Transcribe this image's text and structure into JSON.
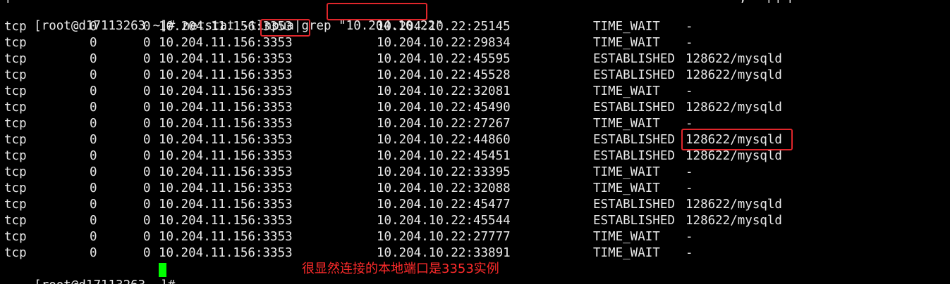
{
  "terminal": {
    "cut_line_fragments": [
      "|",
      ",",
      "|",
      "|",
      "|"
    ],
    "command_prompt": "[root@d17113263 ~]# ",
    "command": "netstat -tlnpua|grep \"10.204.10.22\"",
    "rows": [
      {
        "proto": "tcp",
        "recv_q": "0",
        "send_q": "0",
        "local": "10.204.11.156:3353",
        "foreign": "10.204.10.22:25145",
        "state": "TIME_WAIT",
        "pid": "-"
      },
      {
        "proto": "tcp",
        "recv_q": "0",
        "send_q": "0",
        "local": "10.204.11.156:3353",
        "foreign": "10.204.10.22:29834",
        "state": "TIME_WAIT",
        "pid": "-"
      },
      {
        "proto": "tcp",
        "recv_q": "0",
        "send_q": "0",
        "local": "10.204.11.156:3353",
        "foreign": "10.204.10.22:45595",
        "state": "ESTABLISHED",
        "pid": "128622/mysqld"
      },
      {
        "proto": "tcp",
        "recv_q": "0",
        "send_q": "0",
        "local": "10.204.11.156:3353",
        "foreign": "10.204.10.22:45528",
        "state": "ESTABLISHED",
        "pid": "128622/mysqld"
      },
      {
        "proto": "tcp",
        "recv_q": "0",
        "send_q": "0",
        "local": "10.204.11.156:3353",
        "foreign": "10.204.10.22:32081",
        "state": "TIME_WAIT",
        "pid": "-"
      },
      {
        "proto": "tcp",
        "recv_q": "0",
        "send_q": "0",
        "local": "10.204.11.156:3353",
        "foreign": "10.204.10.22:45490",
        "state": "ESTABLISHED",
        "pid": "128622/mysqld"
      },
      {
        "proto": "tcp",
        "recv_q": "0",
        "send_q": "0",
        "local": "10.204.11.156:3353",
        "foreign": "10.204.10.22:27267",
        "state": "TIME_WAIT",
        "pid": "-"
      },
      {
        "proto": "tcp",
        "recv_q": "0",
        "send_q": "0",
        "local": "10.204.11.156:3353",
        "foreign": "10.204.10.22:44860",
        "state": "ESTABLISHED",
        "pid": "128622/mysqld"
      },
      {
        "proto": "tcp",
        "recv_q": "0",
        "send_q": "0",
        "local": "10.204.11.156:3353",
        "foreign": "10.204.10.22:45451",
        "state": "ESTABLISHED",
        "pid": "128622/mysqld"
      },
      {
        "proto": "tcp",
        "recv_q": "0",
        "send_q": "0",
        "local": "10.204.11.156:3353",
        "foreign": "10.204.10.22:33395",
        "state": "TIME_WAIT",
        "pid": "-"
      },
      {
        "proto": "tcp",
        "recv_q": "0",
        "send_q": "0",
        "local": "10.204.11.156:3353",
        "foreign": "10.204.10.22:32088",
        "state": "TIME_WAIT",
        "pid": "-"
      },
      {
        "proto": "tcp",
        "recv_q": "0",
        "send_q": "0",
        "local": "10.204.11.156:3353",
        "foreign": "10.204.10.22:45477",
        "state": "ESTABLISHED",
        "pid": "128622/mysqld"
      },
      {
        "proto": "tcp",
        "recv_q": "0",
        "send_q": "0",
        "local": "10.204.11.156:3353",
        "foreign": "10.204.10.22:45544",
        "state": "ESTABLISHED",
        "pid": "128622/mysqld"
      },
      {
        "proto": "tcp",
        "recv_q": "0",
        "send_q": "0",
        "local": "10.204.11.156:3353",
        "foreign": "10.204.10.22:27777",
        "state": "TIME_WAIT",
        "pid": "-"
      },
      {
        "proto": "tcp",
        "recv_q": "0",
        "send_q": "0",
        "local": "10.204.11.156:3353",
        "foreign": "10.204.10.22:33891",
        "state": "TIME_WAIT",
        "pid": "-"
      }
    ],
    "final_prompt": "[root@d17113263 ~]# "
  },
  "annotation": {
    "text": "很显然连接的本地端口是3353实例",
    "color": "#ff2b2b"
  },
  "colors": {
    "background": "#000000",
    "foreground": "#e8e8e8",
    "highlight_box": "#e0262b",
    "cursor": "#00ff00"
  }
}
